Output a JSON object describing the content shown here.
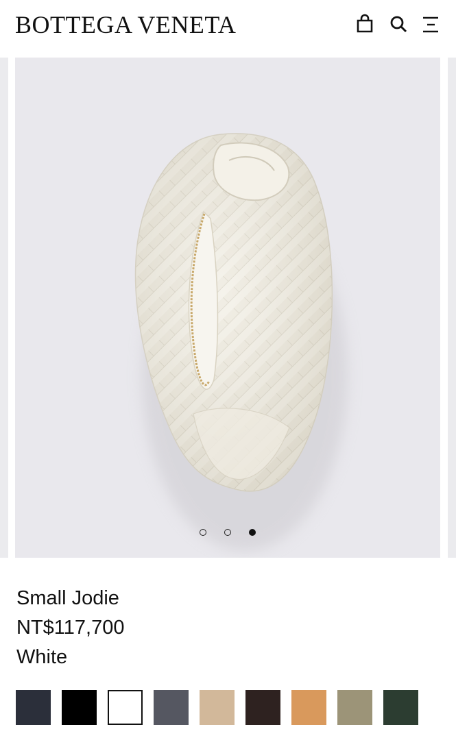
{
  "header": {
    "brand": "BOTTEGA VENETA",
    "icons": [
      "shopping-bag-icon",
      "search-icon",
      "menu-icon"
    ]
  },
  "gallery": {
    "slide_count": 3,
    "active_slide": 3,
    "background_color": "#e9e8ed"
  },
  "product": {
    "name": "Small Jodie",
    "price": "NT$117,700",
    "color": "White"
  },
  "swatches": [
    {
      "color": "#2b2f3a"
    },
    {
      "color": "#000000"
    },
    {
      "color": "#ffffff",
      "selected": true
    },
    {
      "color": "#555761"
    },
    {
      "color": "#d2b89a"
    },
    {
      "color": "#2e2220"
    },
    {
      "color": "#d9995c"
    },
    {
      "color": "#9c9478"
    },
    {
      "color": "#2c3d31"
    }
  ]
}
